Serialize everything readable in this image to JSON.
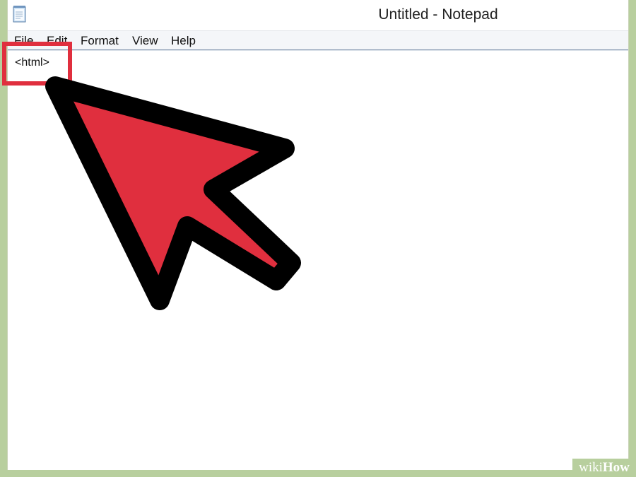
{
  "window": {
    "title": "Untitled - Notepad"
  },
  "menu": {
    "items": [
      "File",
      "Edit",
      "Format",
      "View",
      "Help"
    ]
  },
  "editor": {
    "content": "<html>"
  },
  "annotation": {
    "highlight_color": "#e02f3e",
    "arrow_color": "#e02f3e"
  },
  "watermark": {
    "prefix": "wiki",
    "suffix": "How"
  },
  "icons": {
    "app": "notepad-icon"
  }
}
